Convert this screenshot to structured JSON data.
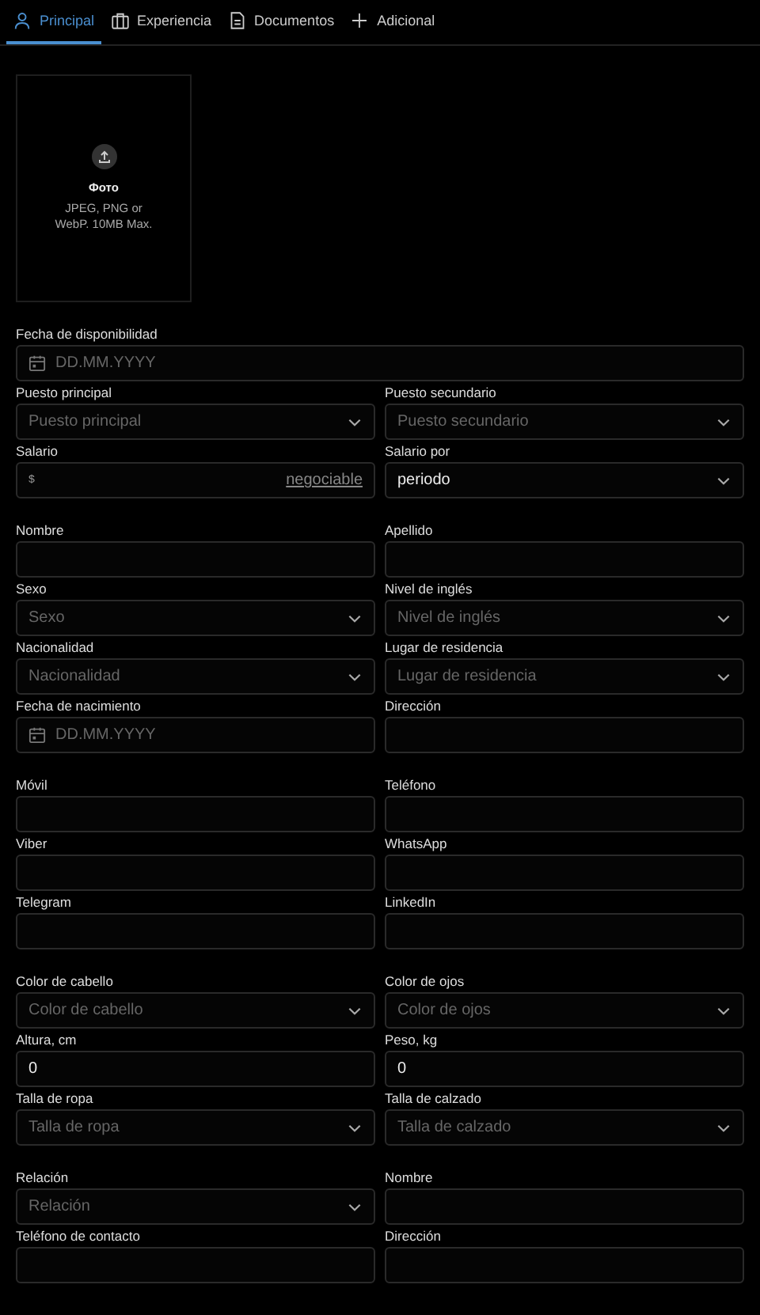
{
  "tabs": [
    {
      "label": "Principal",
      "selected": true
    },
    {
      "label": "Experiencia",
      "selected": false
    },
    {
      "label": "Documentos",
      "selected": false
    },
    {
      "label": "Adicional",
      "selected": false
    }
  ],
  "photo": {
    "title": "Фото",
    "hint": "JPEG, PNG or WebP. 10MB Max."
  },
  "sections": [
    {
      "rows": [
        [
          {
            "label": "Fecha de disponibilidad",
            "kind": "date",
            "placeholder": "DD.MM.YYYY"
          }
        ],
        [
          {
            "label": "Puesto principal",
            "kind": "select",
            "placeholder": "Puesto principal"
          },
          {
            "label": "Puesto secundario",
            "kind": "select",
            "placeholder": "Puesto secundario"
          }
        ],
        [
          {
            "label": "Salario",
            "kind": "salary",
            "prefix": "$",
            "link": "negociable"
          },
          {
            "label": "Salario por",
            "kind": "select",
            "value": "periodo"
          }
        ]
      ]
    },
    {
      "rows": [
        [
          {
            "label": "Nombre",
            "kind": "text"
          },
          {
            "label": "Apellido",
            "kind": "text"
          }
        ],
        [
          {
            "label": "Sexo",
            "kind": "select",
            "placeholder": "Sexo"
          },
          {
            "label": "Nivel de inglés",
            "kind": "select",
            "placeholder": "Nivel de inglés"
          }
        ],
        [
          {
            "label": "Nacionalidad",
            "kind": "select",
            "placeholder": "Nacionalidad"
          },
          {
            "label": "Lugar de residencia",
            "kind": "select",
            "placeholder": "Lugar de residencia"
          }
        ],
        [
          {
            "label": "Fecha de nacimiento",
            "kind": "date",
            "placeholder": "DD.MM.YYYY"
          },
          {
            "label": "Dirección",
            "kind": "text"
          }
        ]
      ]
    },
    {
      "rows": [
        [
          {
            "label": "Móvil",
            "kind": "text"
          },
          {
            "label": "Teléfono",
            "kind": "text"
          }
        ],
        [
          {
            "label": "Viber",
            "kind": "text"
          },
          {
            "label": "WhatsApp",
            "kind": "text"
          }
        ],
        [
          {
            "label": "Telegram",
            "kind": "text"
          },
          {
            "label": "LinkedIn",
            "kind": "text"
          }
        ]
      ]
    },
    {
      "rows": [
        [
          {
            "label": "Color de cabello",
            "kind": "select",
            "placeholder": "Color de cabello"
          },
          {
            "label": "Color de ojos",
            "kind": "select",
            "placeholder": "Color de ojos"
          }
        ],
        [
          {
            "label": "Altura, cm",
            "kind": "text",
            "value": "0"
          },
          {
            "label": "Peso, kg",
            "kind": "text",
            "value": "0"
          }
        ],
        [
          {
            "label": "Talla de ropa",
            "kind": "select",
            "placeholder": "Talla de ropa"
          },
          {
            "label": "Talla de calzado",
            "kind": "select",
            "placeholder": "Talla de calzado"
          }
        ]
      ]
    },
    {
      "rows": [
        [
          {
            "label": "Relación",
            "kind": "select",
            "placeholder": "Relación"
          },
          {
            "label": "Nombre",
            "kind": "text"
          }
        ],
        [
          {
            "label": "Teléfono de contacto",
            "kind": "text"
          },
          {
            "label": "Dirección",
            "kind": "text"
          }
        ]
      ]
    }
  ]
}
